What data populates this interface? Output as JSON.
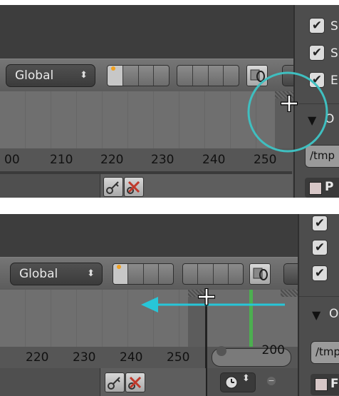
{
  "panel_top": {
    "pivot_dropdown": {
      "label": "Global",
      "arrow": "⬍"
    },
    "timeline_ticks": [
      "00",
      "210",
      "220",
      "230",
      "240",
      "250"
    ],
    "sidebar": {
      "checkbox_labels": [
        "S",
        "S",
        "E"
      ],
      "section_label": "O",
      "path_value": "/tmp",
      "footer_label": "P"
    },
    "icons": [
      "layer-grid-icon",
      "link-icon",
      "cursor-crosshair-icon",
      "keyframe-key-icon",
      "delete-key-icon"
    ],
    "annotation_color": "#3fbfc0"
  },
  "panel_bottom": {
    "pivot_dropdown": {
      "label": "Global",
      "arrow": "⬍"
    },
    "timeline_ticks": [
      "220",
      "230",
      "240",
      "250"
    ],
    "frame_field_value": "200",
    "sidebar": {
      "section_label": "O",
      "path_value": "/tmp",
      "footer_label": "F"
    },
    "icons": [
      "layer-grid-icon",
      "link-icon",
      "cursor-crosshair-icon",
      "keyframe-key-icon",
      "delete-key-icon",
      "clock-icon",
      "minus-icon"
    ],
    "annotation_arrow_color": "#27c6d8",
    "frame_marker_color": "#4caf50"
  }
}
